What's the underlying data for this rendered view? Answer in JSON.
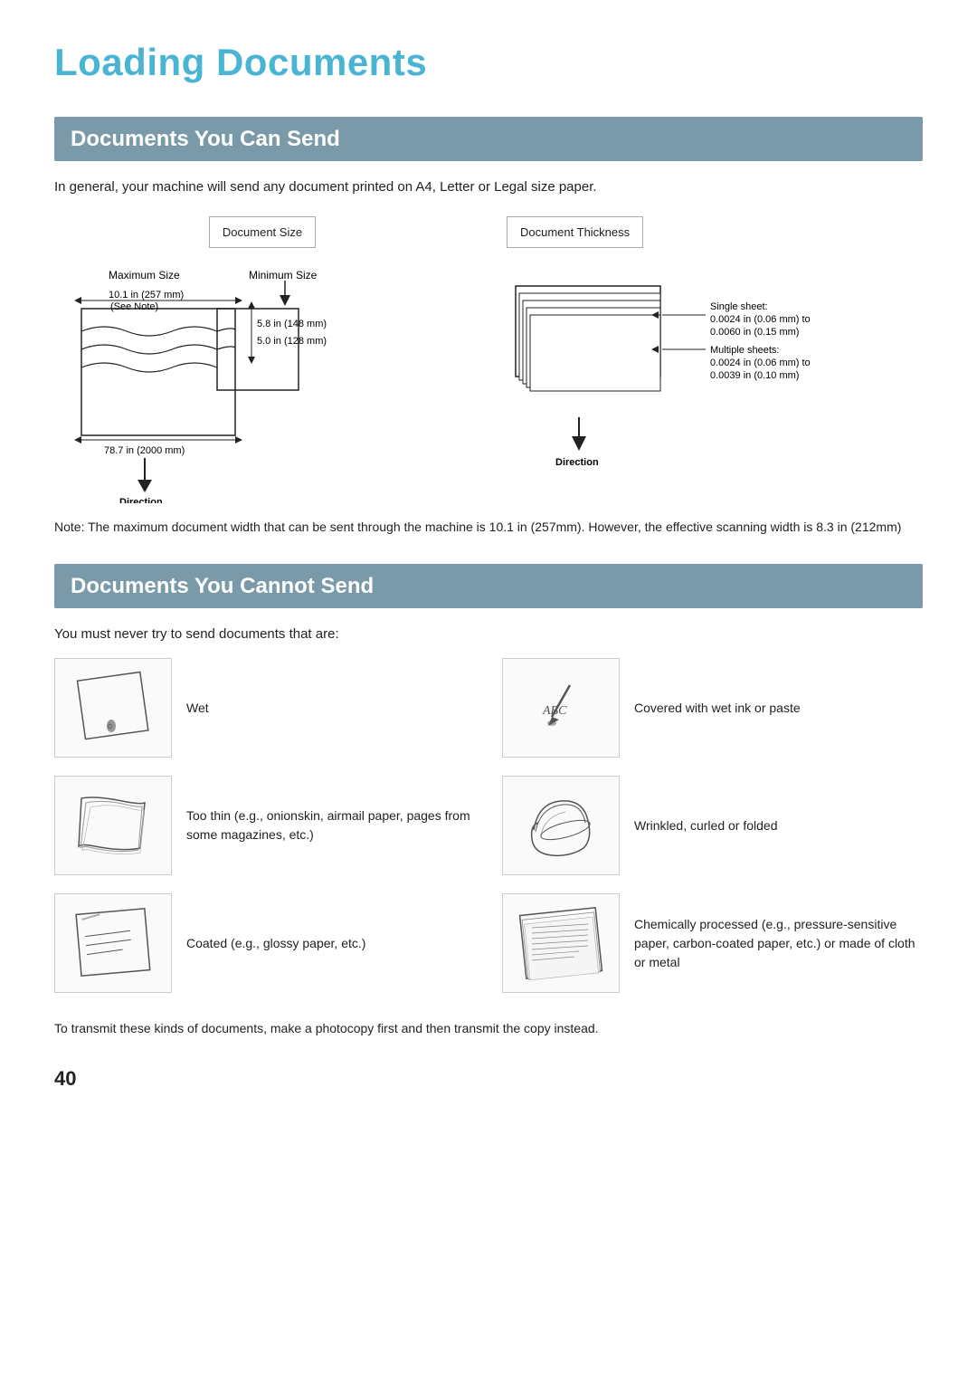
{
  "page": {
    "title": "Loading Documents",
    "number": "40"
  },
  "section1": {
    "header": "Documents You Can Send",
    "intro": "In general, your machine will send any document printed on A4, Letter or Legal size paper.",
    "label_size": "Document Size",
    "label_thickness": "Document Thickness",
    "size_labels": {
      "maximum": "Maximum Size",
      "minimum": "Minimum Size",
      "width1": "10.1 in (257 mm)",
      "see_note": "(See Note)",
      "height1": "5.8 in (148 mm)",
      "height2": "5.0 in (128 mm)",
      "length": "78.7 in (2000 mm)",
      "direction": "Direction"
    },
    "thickness_labels": {
      "single_sheet": "Single sheet:",
      "single_range": "0.0024 in (0.06 mm) to",
      "single_max": "0.0060 in (0.15 mm)",
      "multiple_sheets": "Multiple sheets:",
      "multiple_range": "0.0024 in (0.06 mm) to",
      "multiple_max": "0.0039 in (0.10 mm)",
      "direction": "Direction"
    },
    "note": "Note: The maximum document width that can be sent through the machine is 10.1 in (257mm). However,\nthe effective scanning width is 8.3 in (212mm)"
  },
  "section2": {
    "header": "Documents You Cannot Send",
    "intro": "You must never try to send documents that are:",
    "items": [
      {
        "id": "wet",
        "label": "Wet"
      },
      {
        "id": "wet-ink",
        "label": "Covered with wet ink or paste"
      },
      {
        "id": "thin",
        "label": "Too thin (e.g., onionskin, airmail paper, pages from some magazines, etc.)"
      },
      {
        "id": "wrinkled",
        "label": "Wrinkled, curled or folded"
      },
      {
        "id": "coated",
        "label": "Coated (e.g., glossy paper, etc.)"
      },
      {
        "id": "chemical",
        "label": "Chemically processed (e.g., pressure-sensitive paper, carbon-coated paper, etc.) or made of cloth or metal"
      }
    ],
    "footer": "To transmit these kinds of documents, make a photocopy first and then transmit the copy instead."
  }
}
